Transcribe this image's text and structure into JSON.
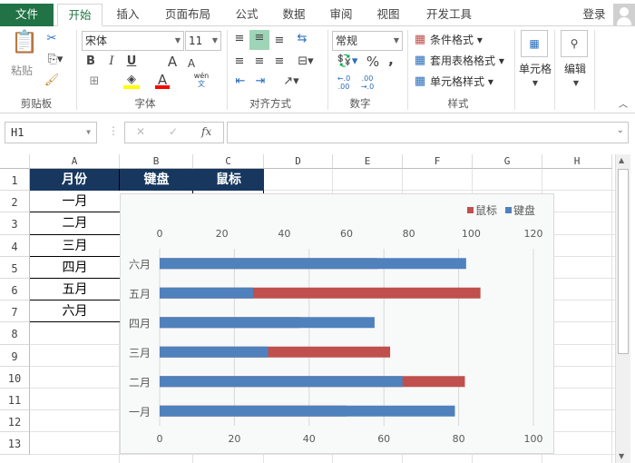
{
  "tabs": [
    "文件",
    "开始",
    "插入",
    "页面布局",
    "公式",
    "数据",
    "审阅",
    "视图",
    "开发工具"
  ],
  "login": "登录",
  "ribbon": {
    "clipboard": {
      "paste": "粘贴",
      "label": "剪贴板"
    },
    "font": {
      "name": "宋体",
      "size": "11",
      "bold": "B",
      "italic": "I",
      "underline": "U",
      "grow": "A",
      "shrink": "A",
      "fill_color": "#ffff00",
      "font_color": "#ff0000",
      "phonetic_top": "wén",
      "phonetic_bottom": "文",
      "label": "字体"
    },
    "align": {
      "label": "对齐方式"
    },
    "number": {
      "format": "常规",
      "percent": "%",
      "comma": ",",
      "inc": "←.0\n.00",
      "dec": ".00\n→.0",
      "label": "数字"
    },
    "styles": {
      "cond": "条件格式",
      "table": "套用表格格式",
      "cell": "单元格样式",
      "label": "样式"
    },
    "cells": {
      "label": "单元格"
    },
    "editing": {
      "label": "编辑"
    }
  },
  "formula_bar": {
    "name_box": "H1",
    "cancel": "✕",
    "enter": "✓",
    "fx": "fx",
    "value": ""
  },
  "columns": [
    "A",
    "B",
    "C",
    "D",
    "E",
    "F",
    "G",
    "H"
  ],
  "rows": [
    "1",
    "2",
    "3",
    "4",
    "5",
    "6",
    "7",
    "8",
    "9",
    "10",
    "11",
    "12",
    "13"
  ],
  "table": {
    "headers": [
      "月份",
      "键盘",
      "鼠标"
    ],
    "months": [
      "一月",
      "二月",
      "三月",
      "四月",
      "五月",
      "六月"
    ]
  },
  "chart_data": {
    "type": "bar",
    "orientation": "horizontal",
    "categories": [
      "一月",
      "二月",
      "三月",
      "四月",
      "五月",
      "六月"
    ],
    "series": [
      {
        "name": "键盘",
        "axis": "primary-bottom",
        "color": "#4f81bd",
        "values": [
          79,
          65,
          29,
          57.5,
          25,
          82
        ]
      },
      {
        "name": "鼠标",
        "axis": "secondary-top",
        "color": "#c0504d",
        "values": [
          60,
          98,
          74,
          45,
          103,
          70
        ]
      }
    ],
    "primary_axis": {
      "range": [
        0,
        100
      ],
      "ticks": [
        "0",
        "20",
        "40",
        "60",
        "80",
        "100"
      ]
    },
    "secondary_axis": {
      "range": [
        0,
        120
      ],
      "ticks": [
        "0",
        "20",
        "40",
        "60",
        "80",
        "100",
        "120"
      ]
    },
    "legend": {
      "placement": "top-right",
      "entries": [
        "鼠标",
        "键盘"
      ]
    },
    "grid": true
  }
}
